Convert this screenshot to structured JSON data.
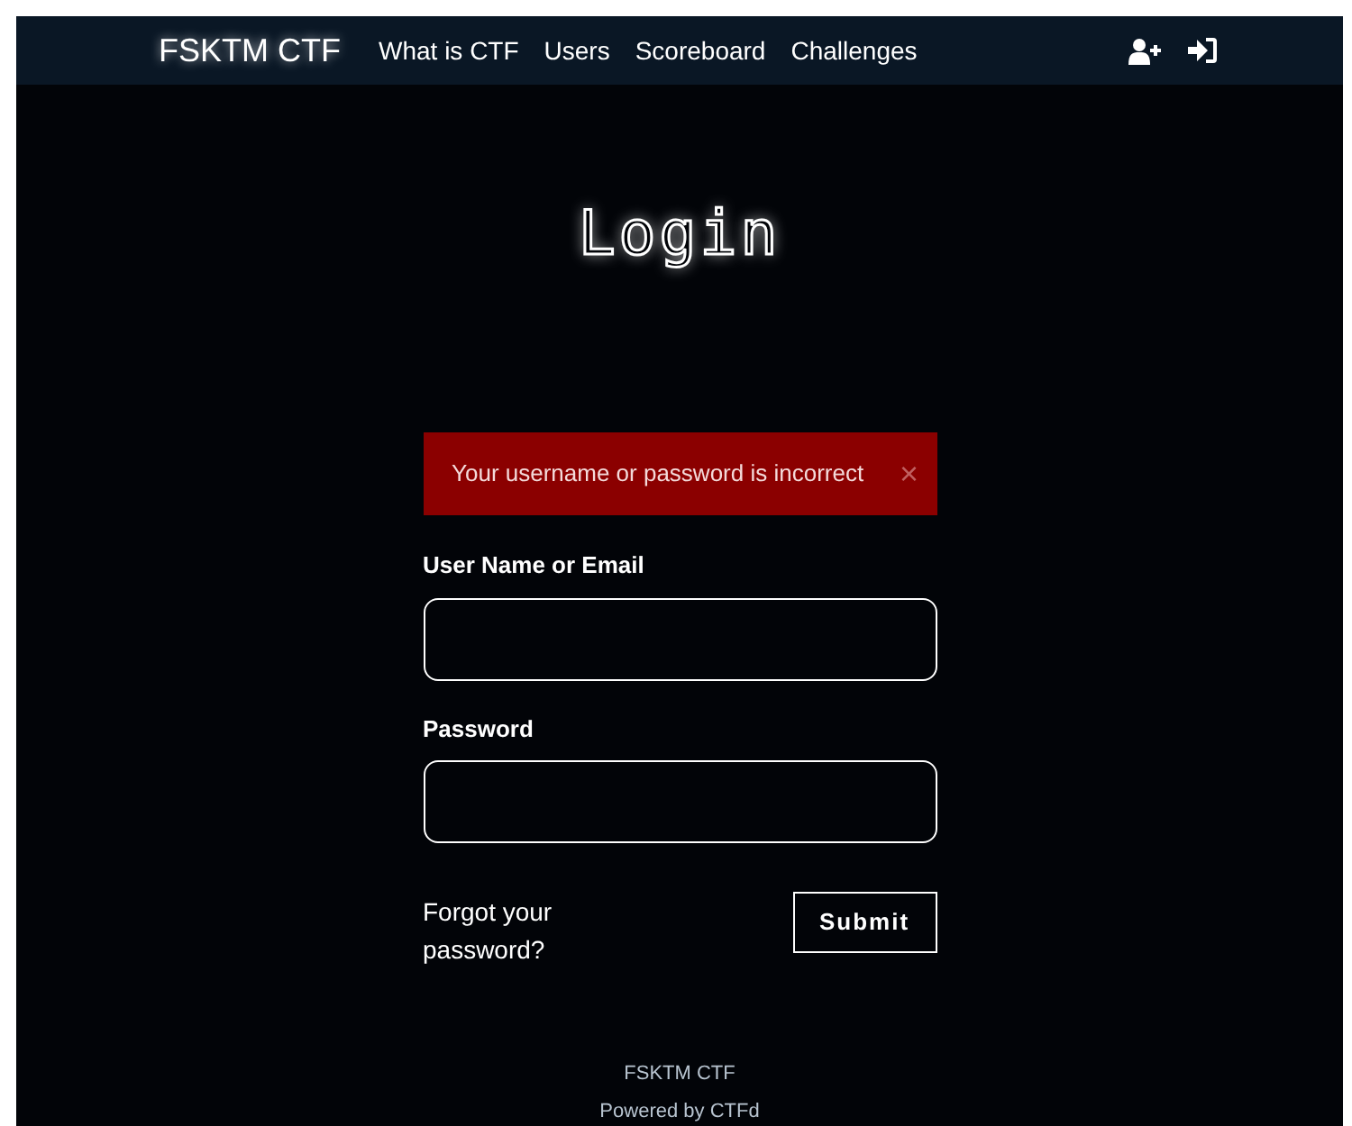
{
  "navbar": {
    "brand": "FSKTM CTF",
    "links": [
      "What is CTF",
      "Users",
      "Scoreboard",
      "Challenges"
    ]
  },
  "page": {
    "title": "Login"
  },
  "alert": {
    "message": "Your username or password is incorrect",
    "close": "×"
  },
  "form": {
    "fields": [
      {
        "label": "User Name or Email"
      },
      {
        "label": "Password"
      }
    ],
    "forgot_link": "Forgot your password?",
    "submit": "Submit"
  },
  "footer": {
    "name": "FSKTM CTF",
    "powered": "Powered by CTFd"
  }
}
